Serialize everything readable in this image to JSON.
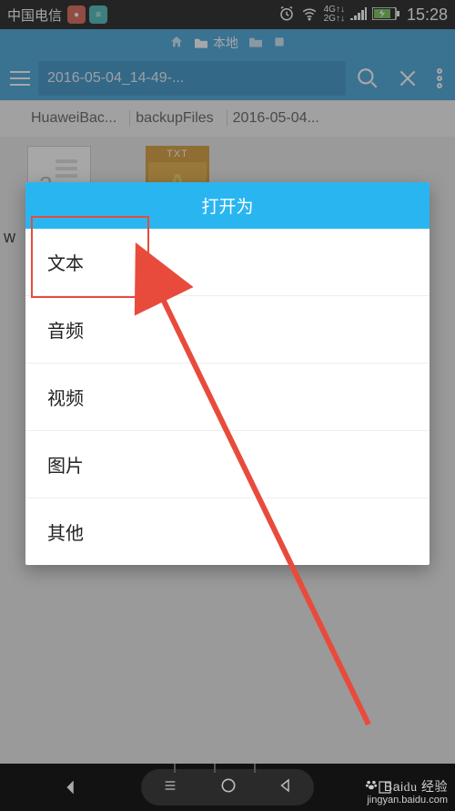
{
  "status": {
    "carrier": "中国电信",
    "alarm": "⏰",
    "wifi": "wifi",
    "net_top": "4G",
    "net_bot": "2G",
    "battery": "76",
    "time": "15:28"
  },
  "tabrow": {
    "home_icon": "🏠",
    "folder_icon": "📁",
    "local_label": "本地",
    "dot1": "▪",
    "dot2": "▪"
  },
  "header": {
    "title": "2016-05-04_14-49-..."
  },
  "crumbs": {
    "c1": "HuaweiBac...",
    "c2": "backupFiles",
    "c3": "2016-05-04..."
  },
  "files": {
    "f1": "2",
    "f2": "w"
  },
  "stray": "w",
  "dialog": {
    "title": "打开为",
    "items": [
      "文本",
      "音频",
      "视频",
      "图片",
      "其他"
    ]
  },
  "watermark": {
    "brand": "Bai",
    "brand2": "经验",
    "url": "jingyan.baidu.com"
  }
}
